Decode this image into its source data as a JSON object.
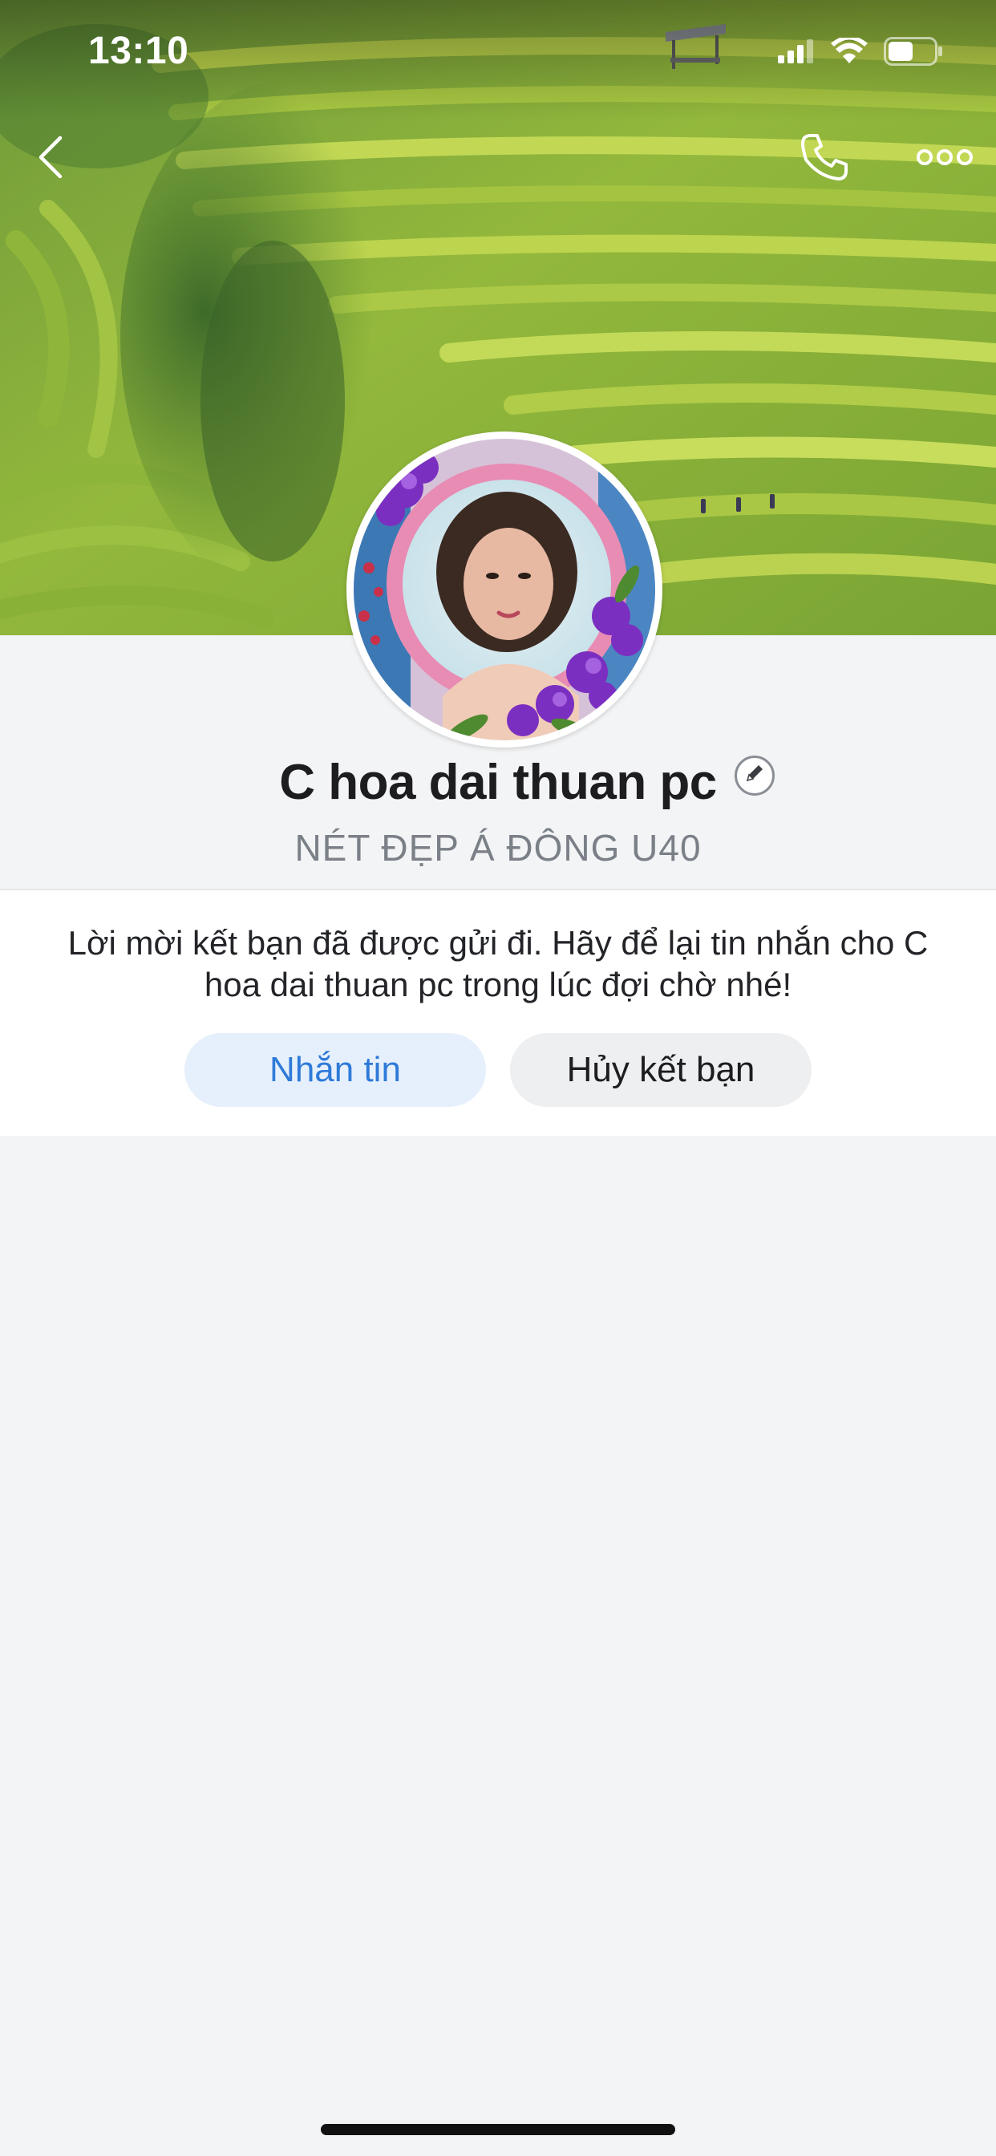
{
  "status_bar": {
    "time": "13:10"
  },
  "navigation": {
    "back_icon": "chevron-left-icon",
    "call_icon": "phone-icon",
    "more_icon": "more-horizontal-icon"
  },
  "profile": {
    "name": "C hoa dai thuan pc",
    "status": "NÉT ĐẸP Á ĐÔNG U40",
    "edit_icon": "pencil-icon"
  },
  "friend_request": {
    "notice": "Lời mời kết bạn đã được gửi đi. Hãy để lại tin nhắn cho C hoa dai thuan pc trong lúc đợi chờ nhé!",
    "message_label": "Nhắn tin",
    "unfriend_label": "Hủy kết bạn"
  },
  "colors": {
    "accent": "#2f7ad9",
    "accent_bg": "#e6f0fc",
    "background": "#f3f4f5"
  }
}
